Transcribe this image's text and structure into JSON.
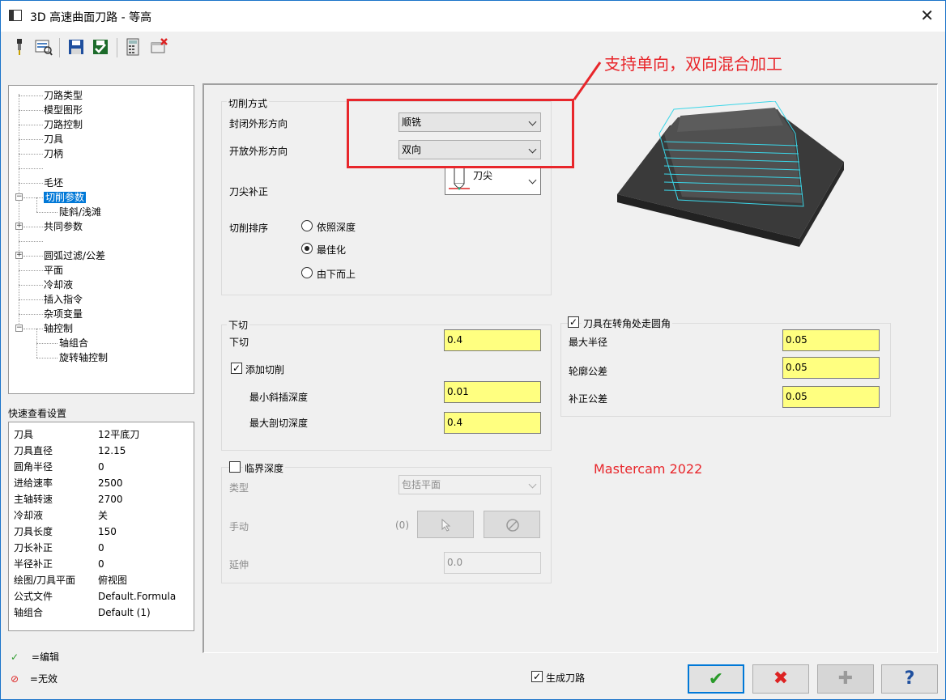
{
  "window": {
    "title": "3D 高速曲面刀路 - 等高",
    "close_glyph": "✕"
  },
  "toolbar": {
    "icons": [
      "tool-icon",
      "view-icon",
      "save-icon",
      "save-green-icon",
      "calculator-icon",
      "delete-icon"
    ]
  },
  "tree": {
    "items": [
      "刀路类型",
      "模型图形",
      "刀路控制",
      "刀具",
      "刀柄",
      "毛坯",
      "切削参数",
      "陡斜/浅滩",
      "共同参数",
      "圆弧过滤/公差",
      "平面",
      "冷却液",
      "插入指令",
      "杂项变量",
      "轴控制",
      "轴组合",
      "旋转轴控制"
    ]
  },
  "quickview": {
    "label": "快速查看设置",
    "rows": [
      {
        "k": "刀具",
        "v": "12平底刀"
      },
      {
        "k": "刀具直径",
        "v": "12.15"
      },
      {
        "k": "圆角半径",
        "v": "0"
      },
      {
        "k": "进给速率",
        "v": "2500"
      },
      {
        "k": "主轴转速",
        "v": "2700"
      },
      {
        "k": "冷却液",
        "v": "关"
      },
      {
        "k": "刀具长度",
        "v": "150"
      },
      {
        "k": "刀长补正",
        "v": "0"
      },
      {
        "k": "半径补正",
        "v": "0"
      },
      {
        "k": "绘图/刀具平面",
        "v": "俯视图"
      },
      {
        "k": "公式文件",
        "v": "Default.Formula"
      },
      {
        "k": "轴组合",
        "v": "Default (1)"
      }
    ]
  },
  "legend": {
    "edit": "=编辑",
    "invalid": "=无效"
  },
  "cutting": {
    "title": "切削方式",
    "closed_label": "封闭外形方向",
    "closed_value": "顺铣",
    "open_label": "开放外形方向",
    "open_value": "双向",
    "tip_label": "刀尖补正",
    "tip_value": "刀尖",
    "order_label": "切削排序",
    "order_options": [
      "依照深度",
      "最佳化",
      "由下而上"
    ],
    "order_selected": "最佳化"
  },
  "annotation": {
    "text": "支持单向，双向混合加工",
    "color": "#e8262b",
    "version": "Mastercam 2022"
  },
  "stepdown": {
    "title": "下切",
    "label": "下切",
    "value": "0.4",
    "add_label": "添加切削",
    "add_checked": true,
    "min_label": "最小斜插深度",
    "min_value": "0.01",
    "max_label": "最大剖切深度",
    "max_value": "0.4"
  },
  "corner": {
    "title": "刀具在转角处走圆角",
    "checked": true,
    "radius_label": "最大半径",
    "radius_value": "0.05",
    "profile_label": "轮廓公差",
    "profile_value": "0.05",
    "comp_label": "补正公差",
    "comp_value": "0.05"
  },
  "critical": {
    "title": "临界深度",
    "checked": false,
    "type_label": "类型",
    "type_value": "包括平面",
    "manual_label": "手动",
    "manual_count": "(0)",
    "extend_label": "延伸",
    "extend_value": "0.0"
  },
  "footer": {
    "generate_label": "生成刀路",
    "generate_checked": true,
    "ok_glyph": "✔",
    "cancel_glyph": "✖",
    "add_glyph": "✚",
    "help_glyph": "?"
  }
}
